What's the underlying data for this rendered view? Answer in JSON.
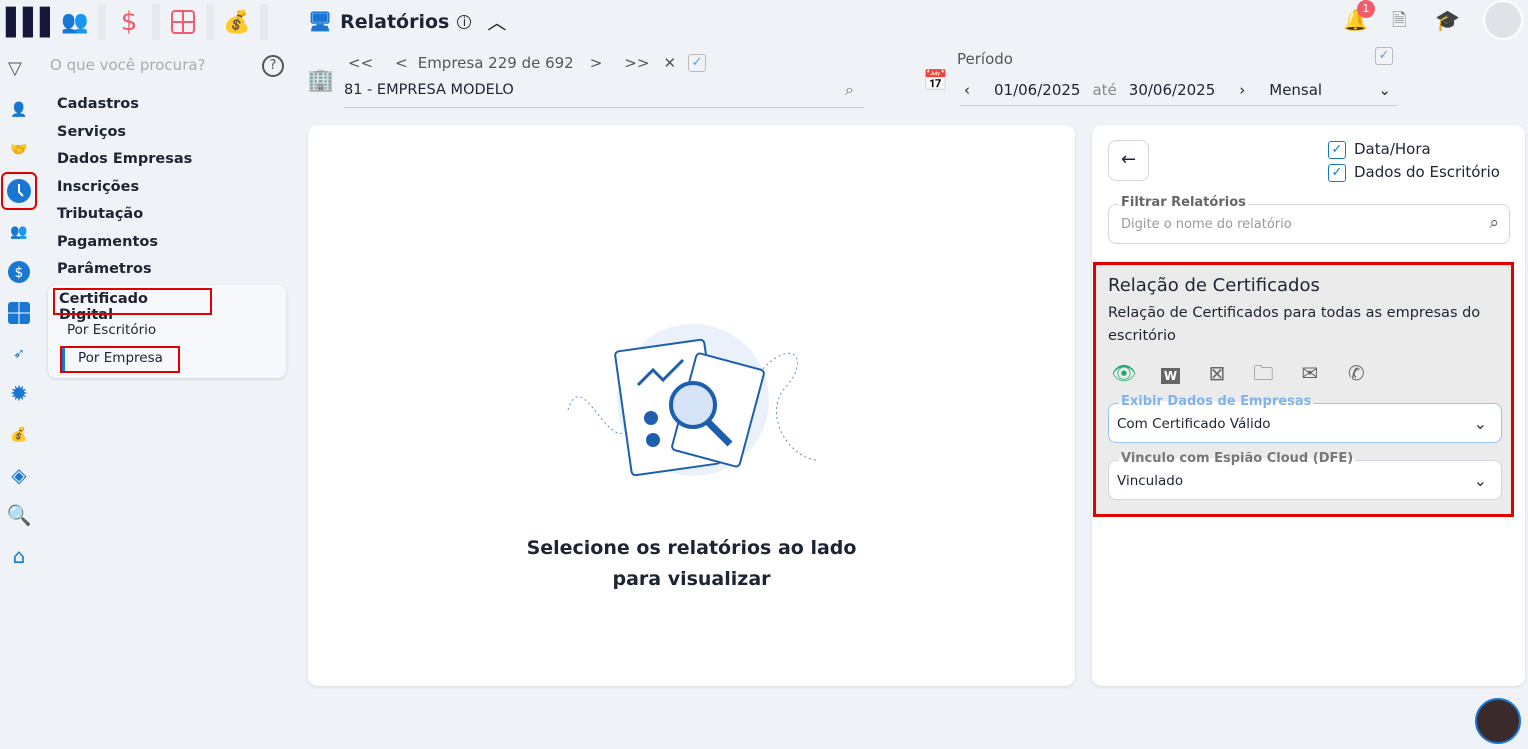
{
  "top_apps": [
    {
      "icon": "people-icon"
    },
    {
      "icon": "dollar-icon"
    },
    {
      "icon": "calculator-icon"
    },
    {
      "icon": "money-bag-icon"
    }
  ],
  "search": {
    "placeholder": "O que você procura?"
  },
  "menu": {
    "items": [
      "Cadastros",
      "Serviços",
      "Dados Empresas",
      "Inscrições",
      "Tributação",
      "Pagamentos",
      "Parâmetros"
    ],
    "expanded": {
      "label": "Certificado Digital",
      "children": [
        "Por Escritório",
        "Por Empresa"
      ],
      "active": "Por Empresa"
    }
  },
  "header": {
    "title": "Relatórios",
    "notification_count": "1"
  },
  "company_nav": {
    "label": "Empresa 229 de 692",
    "first": "<<",
    "prev": "<",
    "next": ">",
    "last": ">>",
    "current": "81 - EMPRESA MODELO"
  },
  "period": {
    "label": "Período",
    "from": "01/06/2025",
    "sep": "até",
    "to": "30/06/2025",
    "mode": "Mensal"
  },
  "main": {
    "empty_line1": "Selecione os relatórios ao lado",
    "empty_line2": "para visualizar"
  },
  "side": {
    "opt_datetime": "Data/Hora",
    "opt_office": "Dados do Escritório",
    "filter_label": "Filtrar Relatórios",
    "filter_placeholder": "Digite o nome do relatório",
    "report": {
      "title": "Relação de Certificados",
      "desc": "Relação de Certificados para todas as empresas do escritório",
      "field1_label": "Exibir Dados de Empresas",
      "field1_value": "Com Certificado Válido",
      "field2_label": "Vinculo com Espião Cloud (DFE)",
      "field2_value": "Vinculado"
    }
  },
  "colors": {
    "accent": "#1976d2",
    "highlight": "#e00000",
    "apps": "#f25c6c"
  }
}
